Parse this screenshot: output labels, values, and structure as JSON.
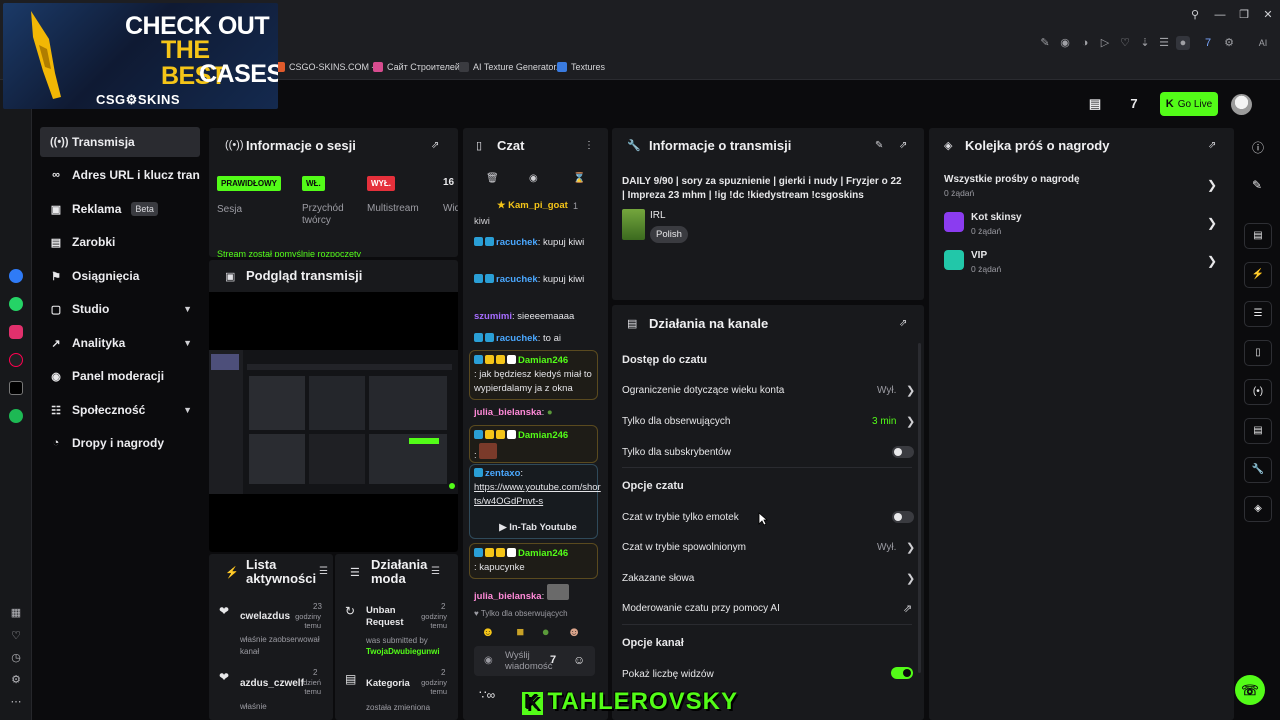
{
  "ad": {
    "line1": "CHECK OUT",
    "line2": "THE BEST",
    "line3": "CASES",
    "logo": "CSG⚙SKINS"
  },
  "bookmarks": [
    {
      "label": "CSGO-SKINS.COM -...",
      "color": "#e05a2b"
    },
    {
      "label": "Сайт Строителей",
      "color": "#d74c8f"
    },
    {
      "label": "AI Texture Generator...",
      "color": "#3a3b40"
    },
    {
      "label": "Textures",
      "color": "#3a7be0"
    }
  ],
  "browser": {
    "ai_label": "AI"
  },
  "header": {
    "go_live": "Go Live"
  },
  "nav": {
    "items": [
      {
        "label": "Transmisja",
        "icon": "broadcast-icon",
        "glyph": "((•))"
      },
      {
        "label": "Adres URL i klucz transmisji",
        "icon": "link-icon",
        "glyph": "∞"
      },
      {
        "label": "Reklama",
        "icon": "ad-icon",
        "glyph": "▣",
        "badge": "Beta"
      },
      {
        "label": "Zarobki",
        "icon": "earnings-icon",
        "glyph": "▤"
      },
      {
        "label": "Osiągnięcia",
        "icon": "trophy-icon",
        "glyph": "⚑"
      },
      {
        "label": "Studio",
        "icon": "studio-icon",
        "glyph": "▢"
      },
      {
        "label": "Analityka",
        "icon": "analytics-icon",
        "glyph": "↗"
      },
      {
        "label": "Panel moderacji",
        "icon": "mod-icon",
        "glyph": "◉"
      },
      {
        "label": "Społeczność",
        "icon": "community-icon",
        "glyph": "☷"
      },
      {
        "label": "Dropy i nagrody",
        "icon": "drops-icon",
        "glyph": "◔"
      }
    ]
  },
  "session": {
    "title": "Informacje o sesji",
    "stats": [
      {
        "tag": "PRAWIDŁOWY",
        "label": "Sesja",
        "color": "#53fc18"
      },
      {
        "tag": "WŁ.",
        "label": "Przychód twórcy",
        "color": "#53fc18"
      },
      {
        "tag": "WYŁ.",
        "label": "Multistream",
        "color": "#e5303b"
      },
      {
        "tag": "16",
        "label": "Wid"
      }
    ],
    "status": "Stream został pomyślnie rozpoczęty"
  },
  "preview": {
    "title": "Podgląd transmisji"
  },
  "viewers": {
    "title_l1": "Lista",
    "title_l2": "aktywności",
    "items": [
      {
        "user": "cwelazdus",
        "time_n": "23",
        "time_u": "godziny temu",
        "desc": "właśnie zaobserwował kanał"
      },
      {
        "user": "azdus_czwelf",
        "time_n": "2",
        "time_u": "dzień temu",
        "desc": "właśnie"
      }
    ]
  },
  "modlog": {
    "title_l1": "Działania",
    "title_l2": "moda",
    "items": [
      {
        "title": "Unban Request",
        "time_n": "2",
        "time_u": "godziny temu",
        "desc": "was submitted by",
        "user": "TwojaDwubiegunwi"
      },
      {
        "title": "Kategoria",
        "time_n": "2",
        "time_u": "godziny temu",
        "desc": "została zmieniona"
      }
    ]
  },
  "chat": {
    "title": "Czat",
    "pinned_user": "Kam_pi_goat",
    "pinned_count": "1",
    "lines": [
      {
        "user": "",
        "text": "kiwi"
      },
      {
        "user": "racuchek",
        "text": ": kupuj kiwi"
      },
      {
        "user": "racuchek",
        "text": ": kupuj kiwi"
      },
      {
        "user": "szumimi",
        "text": ": sieeeemaaaa"
      },
      {
        "user": "racuchek",
        "text": ": to ai"
      },
      {
        "user": "Damian246",
        "text": ": jak będziesz kiedyś miał to wypierdalamy ja z okna"
      },
      {
        "user": "julia_bielanska",
        "text": ":"
      },
      {
        "user": "Damian246",
        "text": ":"
      },
      {
        "user": "zentaxo",
        "text": ":",
        "link": "https://www.youtube.com/shorts/w4OGdPnvt-s",
        "embed": "In-Tab Youtube"
      },
      {
        "user": "Damian246",
        "text": ": kapucynke"
      },
      {
        "user": "julia_bielanska",
        "text": ":"
      }
    ],
    "followers_only": "Tylko dla obserwujących",
    "input_placeholder": "Wyślij wiadomość"
  },
  "stream_info": {
    "title": "Informacje o transmisji",
    "stream_title": "DAILY 9/90 | sory za spuznienie | gierki i nudy | Fryzjer o 22 | Impreza 23 mhm | !ig !dc !kiedystream !csgoskins",
    "category": "IRL",
    "language": "Polish"
  },
  "channel_actions": {
    "title": "Działania na kanale",
    "sections": [
      {
        "heading": "Dostęp do czatu"
      },
      {
        "heading": "Opcje czatu"
      },
      {
        "heading": "Opcje kanał"
      }
    ],
    "rows": [
      {
        "label": "Ograniczenie dotyczące wieku konta",
        "value": "Wył.",
        "type": "chevron"
      },
      {
        "label": "Tylko dla obserwujących",
        "value": "3 min",
        "type": "chevron",
        "value_color": "#53fc18"
      },
      {
        "label": "Tylko dla subskrybentów",
        "type": "toggle",
        "on": false
      },
      {
        "label": "Czat w trybie tylko emotek",
        "type": "toggle",
        "on": false
      },
      {
        "label": "Czat w trybie spowolnionym",
        "value": "Wył.",
        "type": "chevron"
      },
      {
        "label": "Zakazane słowa",
        "type": "chevron"
      },
      {
        "label": "Moderowanie czatu przy pomocy AI",
        "type": "external"
      },
      {
        "label": "Pokaż liczbę widzów",
        "type": "toggle",
        "on": true
      }
    ]
  },
  "rewards": {
    "title": "Kolejka próś o nagrody",
    "all_label": "Wszystkie prośby o nagrodę",
    "all_count": "0 żądań",
    "items": [
      {
        "name": "Kot skinsy",
        "count": "0 żądań",
        "color": "#8b3cf0"
      },
      {
        "name": "VIP",
        "count": "0 żądań",
        "color": "#22c7a9"
      }
    ]
  },
  "watermark": "TAHLEROVSKY"
}
